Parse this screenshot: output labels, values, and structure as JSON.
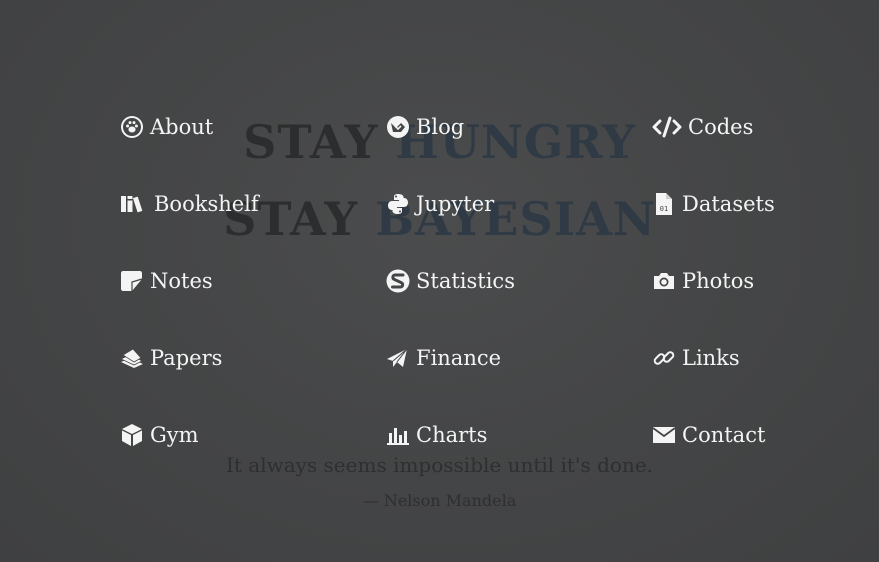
{
  "hero": {
    "line1_word1": "STAY",
    "line1_word2": "HUNGRY",
    "line2_word1": "STAY",
    "line2_word2": "BAYESIAN"
  },
  "quote": {
    "text": "It always seems impossible until it's done.",
    "author": "— Nelson Mandela"
  },
  "menu": {
    "about": {
      "label": "About",
      "icon": "paw-icon"
    },
    "blog": {
      "label": "Blog",
      "icon": "gitlab-ish-icon"
    },
    "codes": {
      "label": "Codes",
      "icon": "code-icon"
    },
    "bookshelf": {
      "label": "Bookshelf",
      "icon": "books-icon"
    },
    "jupyter": {
      "label": "Jupyter",
      "icon": "python-icon"
    },
    "datasets": {
      "label": "Datasets",
      "icon": "binary-file-icon"
    },
    "notes": {
      "label": "Notes",
      "icon": "note-icon"
    },
    "statistics": {
      "label": "Statistics",
      "icon": "s-logo-icon"
    },
    "photos": {
      "label": "Photos",
      "icon": "camera-icon"
    },
    "papers": {
      "label": "Papers",
      "icon": "papers-icon"
    },
    "finance": {
      "label": "Finance",
      "icon": "paper-plane-icon"
    },
    "links": {
      "label": "Links",
      "icon": "link-icon"
    },
    "gym": {
      "label": "Gym",
      "icon": "cube-icon"
    },
    "charts": {
      "label": "Charts",
      "icon": "bar-chart-icon"
    },
    "contact": {
      "label": "Contact",
      "icon": "envelope-icon"
    }
  },
  "colors": {
    "background": "#444546",
    "hero_text": "#2c2d2e",
    "hero_accent": "#2f3a45",
    "menu_text": "#f4f4f4"
  }
}
